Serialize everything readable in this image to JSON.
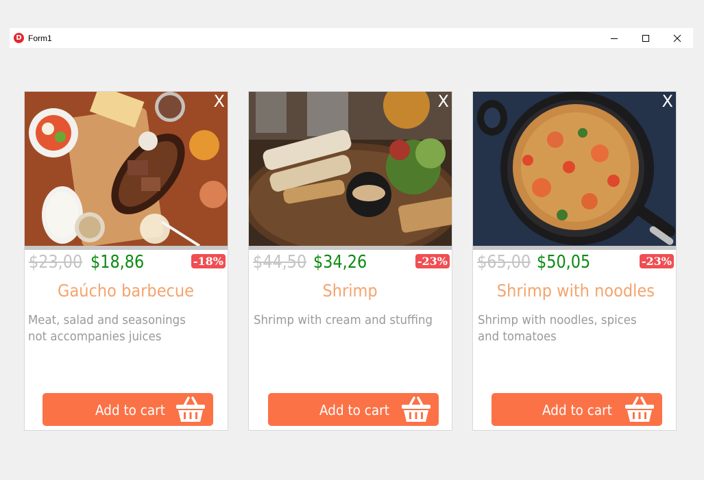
{
  "window": {
    "title": "Form1",
    "icon": "delphi-app-icon"
  },
  "products": [
    {
      "old_price": "$23,00",
      "new_price": "$18,86",
      "discount": "-18%",
      "name": "Gaúcho barbecue",
      "description_lines": [
        "Meat, salad and seasonings",
        "not accompanies juices"
      ],
      "close_label": "X",
      "cart_label": "Add to cart",
      "image": "barbecue-platter-photo"
    },
    {
      "old_price": "$44,50",
      "new_price": "$34,26",
      "discount": "-23%",
      "name": "Shrimp",
      "description_lines": [
        "Shrimp with cream and stuffing"
      ],
      "close_label": "X",
      "cart_label": "Add to cart",
      "image": "shrimp-plate-photo"
    },
    {
      "old_price": "$65,00",
      "new_price": "$50,05",
      "discount": "-23%",
      "name": "Shrimp with noodles",
      "description_lines": [
        "Shrimp with noodles, spices",
        "and tomatoes"
      ],
      "close_label": "X",
      "cart_label": "Add to cart",
      "image": "shrimp-noodles-pan-photo"
    }
  ],
  "colors": {
    "button": "#fb7247",
    "badge": "#f04e52",
    "new_price": "#0c8a12",
    "old_price": "#c4c4c4",
    "name": "#f4a46e",
    "description": "#9a9a9a"
  }
}
